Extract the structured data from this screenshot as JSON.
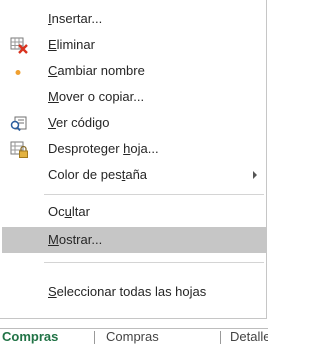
{
  "menu": {
    "items": [
      {
        "pre": "",
        "ul": "I",
        "post": "nsertar...",
        "icon": ""
      },
      {
        "pre": "",
        "ul": "E",
        "post": "liminar",
        "icon": "delete-sheet-icon"
      },
      {
        "pre": "",
        "ul": "C",
        "post": "ambiar nombre",
        "icon": "bullet-icon"
      },
      {
        "pre": "",
        "ul": "M",
        "post": "over o copiar...",
        "icon": ""
      },
      {
        "pre": "",
        "ul": "V",
        "post": "er código",
        "icon": "view-code-icon"
      },
      {
        "pre": "Desproteger ",
        "ul": "h",
        "post": "oja...",
        "icon": "unprotect-sheet-icon"
      },
      {
        "pre": "Color de pes",
        "ul": "t",
        "post": "aña",
        "icon": ""
      },
      {
        "pre": "Oc",
        "ul": "u",
        "post": "ltar",
        "icon": ""
      },
      {
        "pre": "",
        "ul": "M",
        "post": "ostrar...",
        "icon": ""
      },
      {
        "pre": "",
        "ul": "S",
        "post": "eleccionar todas las hojas",
        "icon": ""
      }
    ]
  },
  "tabs": [
    "Compras",
    "Compras",
    "Detalle"
  ],
  "colors": {
    "highlight": "#c6c6c6",
    "accent_red": "#d9331f",
    "bullet_orange": "#f0a030",
    "tab_green": "#217346"
  }
}
